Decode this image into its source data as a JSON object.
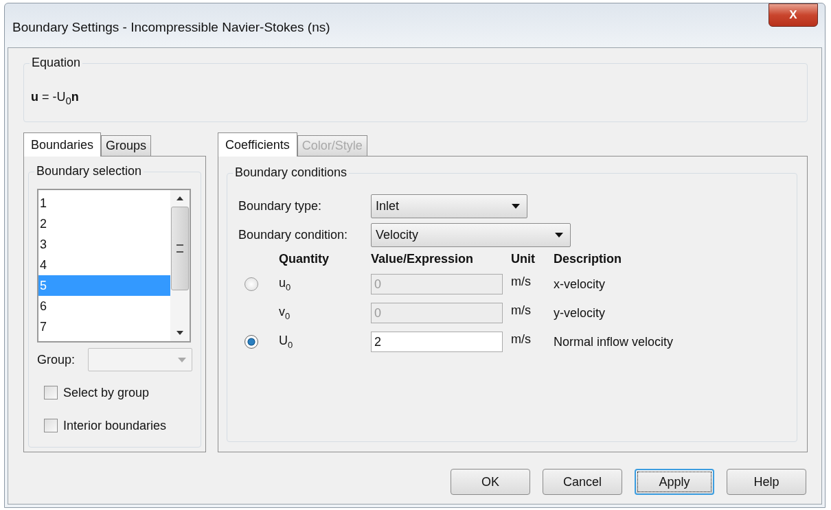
{
  "window": {
    "title": "Boundary Settings - Incompressible Navier-Stokes (ns)",
    "close": "X"
  },
  "equation": {
    "title": "Equation",
    "text": "**u** = -U$_{0}$**n**"
  },
  "left_tabs": [
    {
      "label": "Boundaries",
      "selected": true
    },
    {
      "label": "Groups",
      "selected": false
    }
  ],
  "boundary_selection": {
    "title": "Boundary selection",
    "items": [
      {
        "label": "1",
        "selected": false
      },
      {
        "label": "2",
        "selected": false
      },
      {
        "label": "3",
        "selected": false
      },
      {
        "label": "4",
        "selected": false
      },
      {
        "label": "5",
        "selected": true
      },
      {
        "label": "6",
        "selected": false
      },
      {
        "label": "7",
        "selected": false
      }
    ],
    "group_label": "Group:",
    "group_disabled": true,
    "checkboxes": [
      {
        "label": "Select by group",
        "checked": false
      },
      {
        "label": "Interior boundaries",
        "checked": false
      }
    ]
  },
  "right_tabs": [
    {
      "label": "Coefficients",
      "selected": true,
      "disabled": false
    },
    {
      "label": "Color/Style",
      "selected": false,
      "disabled": true
    }
  ],
  "boundary_conditions": {
    "title": "Boundary conditions",
    "type_label": "Boundary type:",
    "type_value": "Inlet",
    "condition_label": "Boundary condition:",
    "condition_value": "Velocity",
    "columns": [
      "Quantity",
      "Value/Expression",
      "Unit",
      "Description"
    ],
    "rows": [
      {
        "kind": "radio",
        "selected": false,
        "quantity": "u$_{0}$",
        "value": "0",
        "disabled": true,
        "unit": "m/s",
        "description": "x-velocity"
      },
      {
        "kind": "plain",
        "quantity": "v$_{0}$",
        "value": "0",
        "disabled": true,
        "unit": "m/s",
        "description": "y-velocity"
      },
      {
        "kind": "radio",
        "selected": true,
        "quantity": "U$_{0}$",
        "value": "2",
        "disabled": false,
        "unit": "m/s",
        "description": "Normal inflow velocity"
      }
    ]
  },
  "buttons": [
    {
      "label": "OK",
      "focused": false
    },
    {
      "label": "Cancel",
      "focused": false
    },
    {
      "label": "Apply",
      "focused": true
    },
    {
      "label": "Help",
      "focused": false
    }
  ]
}
